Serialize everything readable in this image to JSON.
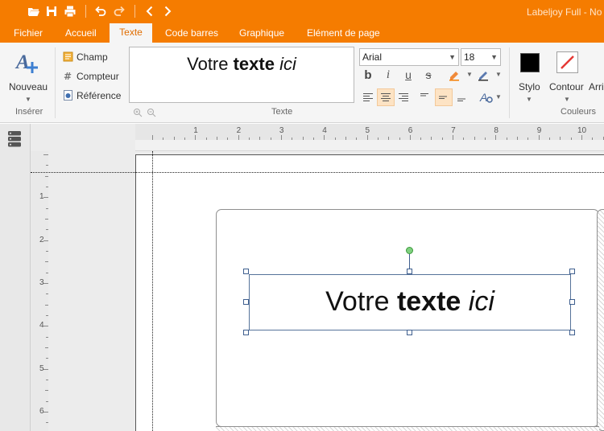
{
  "app": {
    "title": "Labeljoy Full - No"
  },
  "quick_access": {
    "icons": [
      "open-folder-icon",
      "save-icon",
      "print-icon",
      "undo-icon",
      "redo-icon",
      "back-icon",
      "forward-icon"
    ]
  },
  "tabs": [
    {
      "label": "Fichier",
      "active": false
    },
    {
      "label": "Accueil",
      "active": false
    },
    {
      "label": "Texte",
      "active": true
    },
    {
      "label": "Code barres",
      "active": false
    },
    {
      "label": "Graphique",
      "active": false
    },
    {
      "label": "Elément de page",
      "active": false
    }
  ],
  "ribbon": {
    "inserer": {
      "group_label": "Insérer",
      "nouveau_label": "Nouveau"
    },
    "fields": {
      "champ_label": "Champ",
      "compteur_label": "Compteur",
      "reference_label": "Référence"
    },
    "texte": {
      "group_label": "Texte",
      "preview": {
        "normal": "Votre ",
        "bold": "texte",
        "italic": "ici"
      },
      "font_name": "Arial",
      "font_size": "18",
      "format_buttons": [
        "bold-icon",
        "italic-icon",
        "underline-icon",
        "strikethrough-icon",
        "highlight-icon",
        "font-color-icon"
      ],
      "align_buttons": [
        "align-left-icon",
        "align-center-icon",
        "align-right-icon",
        "valign-top-icon",
        "valign-middle-icon",
        "valign-bottom-icon",
        "text-effects-icon"
      ],
      "selected_align": "align-center",
      "selected_valign": "valign-middle"
    },
    "couleurs": {
      "group_label": "Couleurs",
      "stylo_label": "Stylo",
      "contour_label": "Contour",
      "arriere_label": "Arri",
      "stylo_color": "#000000",
      "contour_color": "#e53935"
    }
  },
  "rulers": {
    "horizontal": [
      "1",
      "2",
      "3",
      "4",
      "5",
      "6",
      "7",
      "8",
      "9",
      "10"
    ],
    "vertical": [
      "1",
      "2",
      "3",
      "4",
      "5",
      "6"
    ]
  },
  "canvas": {
    "text_object": {
      "normal": "Votre ",
      "bold": "texte",
      "italic": "ici"
    }
  },
  "colors": {
    "accent": "#f57c00",
    "selection": "#3f5f8f"
  }
}
